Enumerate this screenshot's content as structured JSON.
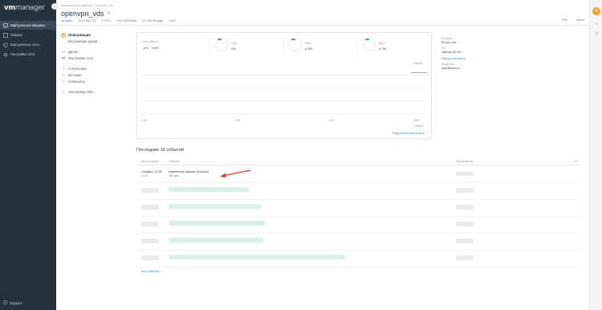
{
  "app": {
    "logo_brand": "vm",
    "logo_rest": "manager"
  },
  "sidebar": {
    "items": [
      {
        "label": "Виртуальные машины",
        "icon": "monitor-icon"
      },
      {
        "label": "Образы",
        "icon": "image-icon"
      },
      {
        "label": "Виртуальные сети",
        "icon": "network-icon"
      },
      {
        "label": "Настройки сети",
        "icon": "settings-icon"
      }
    ],
    "support_label": "Support"
  },
  "header": {
    "breadcrumb": "Виртуальные машины / openvpn_vds",
    "title": "openvpn_vds",
    "status": "Активна",
    "toolbar_items": [
      "192.168.0.50",
      "1 CPU",
      "1024 MiB RAM",
      "20 GiB Storage",
      "KVM"
    ],
    "topright": [
      "VNC",
      "Меню"
    ]
  },
  "menu": {
    "items": [
      {
        "label": "Информация",
        "icon": "info-icon"
      },
      {
        "label": "Внутренние диски",
        "icon": "disk-icon"
      },
      {
        "label": "Диски",
        "icon": "drive-icon"
      },
      {
        "label": "Настройки сети",
        "icon": "net-icon"
      },
      {
        "label": "Статистика",
        "icon": "stats-icon"
      },
      {
        "label": "История",
        "icon": "history-icon"
      },
      {
        "label": "Снапшоты",
        "icon": "snapshot-icon"
      },
      {
        "label": "Настройка VNC",
        "icon": "vnc-icon"
      }
    ]
  },
  "stats": {
    "network_label": "Сеть, Мбит/с",
    "network_down": "4.9",
    "network_up": "0.02",
    "cpu_label": "CPU",
    "cpu_value": "1%",
    "ram_label": "RAM",
    "ram_value": "0.2%",
    "disk_label": "Диск",
    "disk_value": "0.2%",
    "y_top": "1 Мбит/с",
    "x_ticks": [
      "0:00",
      "6:00",
      "12:00",
      "18:00"
    ],
    "x_last": "0:00",
    "x_last_sub": "1 Мбит/с",
    "link": "Подробная статистика →"
  },
  "info": {
    "ip_label": "IP адрес",
    "ip_value": "92.ххх.ххх",
    "os_label": "ОС",
    "os_value": "Ubuntu 20.04",
    "os_link": "Переустановить",
    "owner_label": "Владелец",
    "owner_value": "user@ххх.ru"
  },
  "events": {
    "title": "Последние 10 событий",
    "headers": [
      "Дата и время",
      "Событие",
      "Пользователь"
    ],
    "first_row": {
      "date": "Сегодня, 12:30",
      "time": "12:30",
      "name": "Изменение пароля Openvpn",
      "status": "Успешно"
    },
    "show_all": "Все события →"
  },
  "colors": {
    "sidebar": "#26333f",
    "accent": "#2e8fd8",
    "success": "#1eb48c",
    "avatar": "#f0a020",
    "arrow": "#d93a2b"
  }
}
